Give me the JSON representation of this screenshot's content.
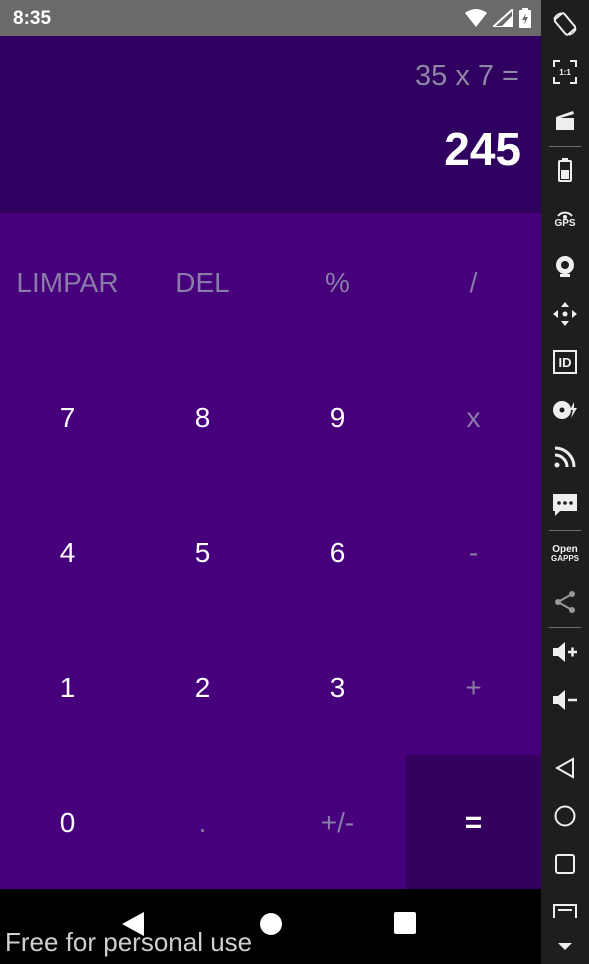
{
  "status_bar": {
    "time": "8:35"
  },
  "display": {
    "expression": "35 x 7 =",
    "result": "245"
  },
  "keypad": {
    "row1": [
      "LIMPAR",
      "DEL",
      "%",
      "/"
    ],
    "row2": [
      "7",
      "8",
      "9",
      "x"
    ],
    "row3": [
      "4",
      "5",
      "6",
      "-"
    ],
    "row4": [
      "1",
      "2",
      "3",
      "+"
    ],
    "row5": [
      "0",
      ".",
      "+/-",
      "="
    ]
  },
  "watermark": "Free for personal use",
  "side_toolbar": {
    "ratio_label": "1:1",
    "gps_label": "GPS",
    "id_label": "ID",
    "opengapps_line1": "Open",
    "opengapps_line2": "GAPPS"
  },
  "colors": {
    "display_bg": "#2f0060",
    "keypad_bg": "#47007c",
    "equals_bg": "#34005e",
    "dim_text": "#8a7ca8"
  }
}
